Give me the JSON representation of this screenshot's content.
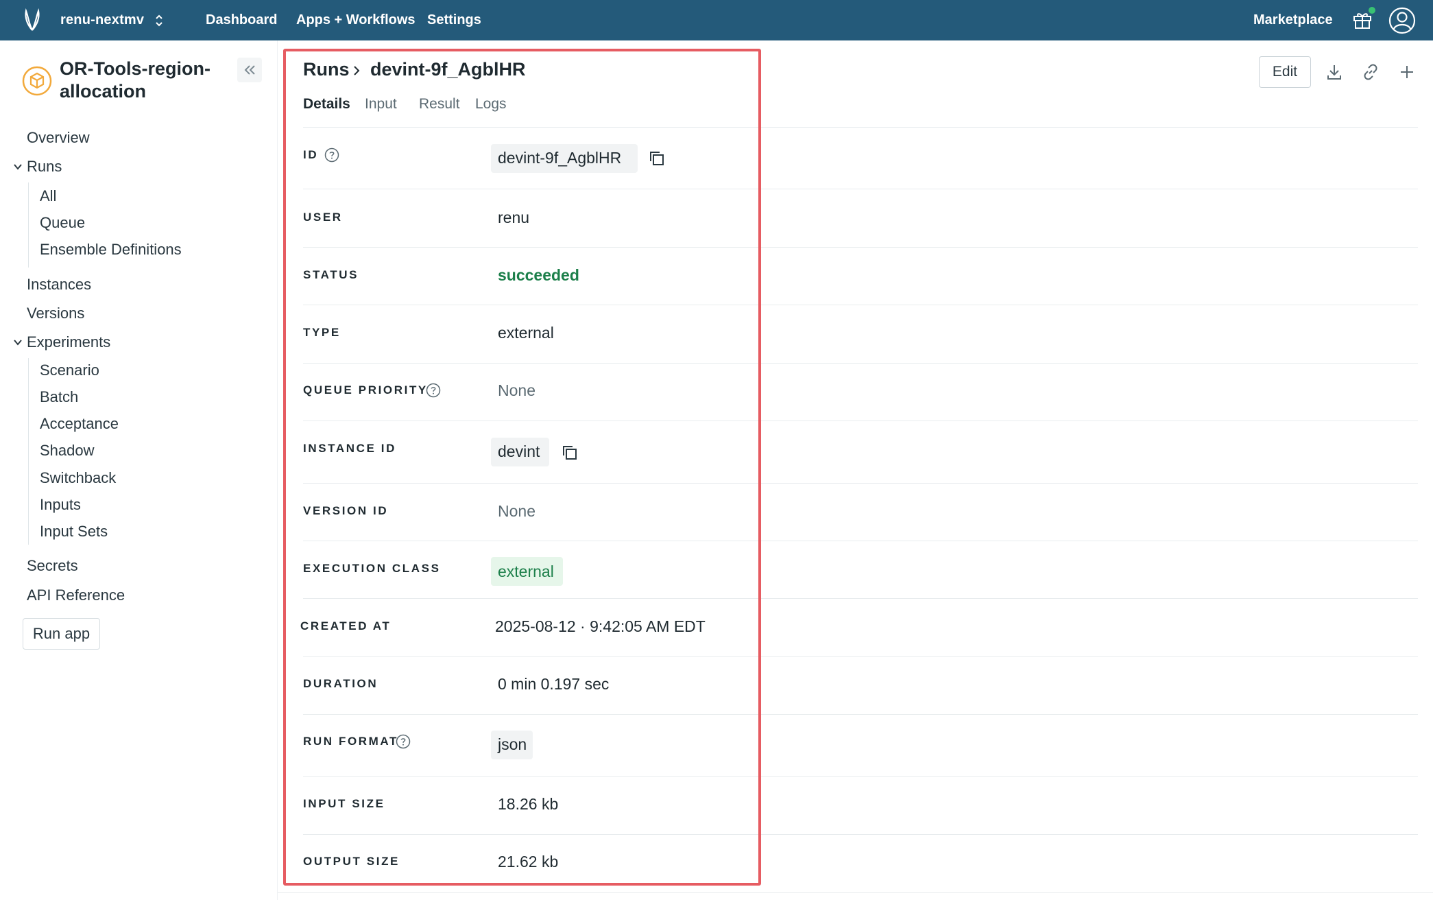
{
  "topbar": {
    "org_name": "renu-nextmv",
    "nav": [
      "Dashboard",
      "Apps + Workflows",
      "Settings"
    ],
    "marketplace": "Marketplace",
    "bg_color": "#245a7a"
  },
  "sidebar": {
    "app_title": "OR-Tools-region-allocation",
    "items": {
      "overview": "Overview",
      "runs": "Runs",
      "runs_all": "All",
      "runs_queue": "Queue",
      "runs_ensemble": "Ensemble Definitions",
      "instances": "Instances",
      "versions": "Versions",
      "experiments": "Experiments",
      "exp_scenario": "Scenario",
      "exp_batch": "Batch",
      "exp_acceptance": "Acceptance",
      "exp_shadow": "Shadow",
      "exp_switchback": "Switchback",
      "exp_inputs": "Inputs",
      "exp_input_sets": "Input Sets",
      "secrets": "Secrets",
      "api_reference": "API Reference"
    },
    "run_app": "Run app"
  },
  "header": {
    "breadcrumb_root": "Runs",
    "breadcrumb_current": "devint-9f_AgblHR",
    "tabs": [
      "Details",
      "Input",
      "Result",
      "Logs"
    ],
    "active_tab": "Details",
    "edit": "Edit"
  },
  "details": {
    "id": {
      "label": "ID",
      "value": "devint-9f_AgblHR"
    },
    "user": {
      "label": "USER",
      "value": "renu"
    },
    "status": {
      "label": "STATUS",
      "value": "succeeded"
    },
    "type": {
      "label": "TYPE",
      "value": "external"
    },
    "queue_priority": {
      "label": "QUEUE PRIORITY",
      "value": "None"
    },
    "instance_id": {
      "label": "INSTANCE ID",
      "value": "devint"
    },
    "version_id": {
      "label": "VERSION ID",
      "value": "None"
    },
    "execution_class": {
      "label": "EXECUTION CLASS",
      "value": "external"
    },
    "created_at": {
      "label": "CREATED AT",
      "value": "2025-08-12 · 9:42:05 AM EDT"
    },
    "duration": {
      "label": "DURATION",
      "value": "0 min 0.197 sec"
    },
    "run_format": {
      "label": "RUN FORMAT",
      "value": "json"
    },
    "input_size": {
      "label": "INPUT SIZE",
      "value": "18.26 kb"
    },
    "output_size": {
      "label": "OUTPUT SIZE",
      "value": "21.62 kb"
    }
  },
  "colors": {
    "success": "#1c7f4a",
    "highlight": "#e65c62",
    "app_icon": "#f2a93b"
  }
}
